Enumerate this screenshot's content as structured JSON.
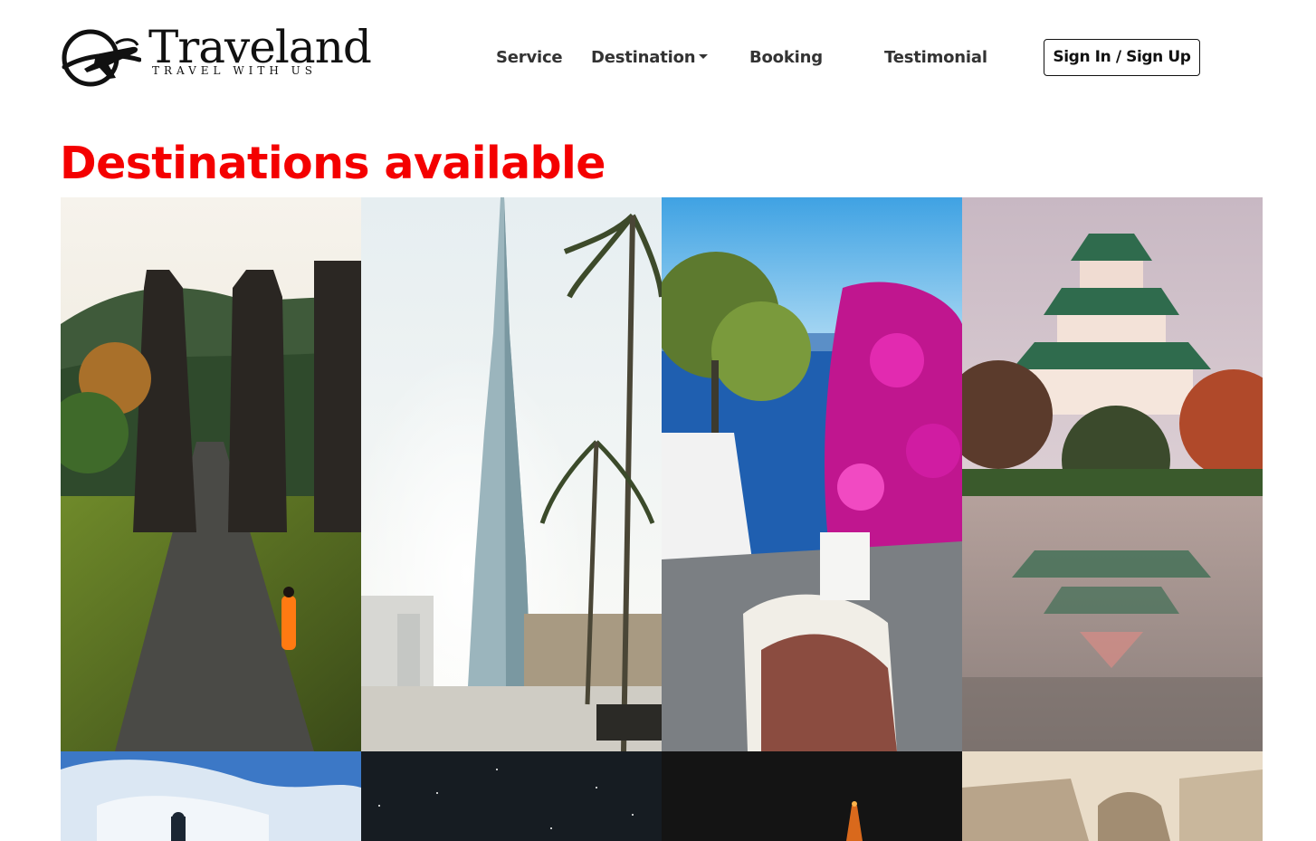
{
  "brand": {
    "name": "Traveland",
    "tagline": "TRAVEL WITH US",
    "logo_icon": "airplane-globe-icon"
  },
  "nav": {
    "items": [
      {
        "label": "Service"
      },
      {
        "label": "Destination",
        "has_dropdown": true
      },
      {
        "label": "Booking"
      },
      {
        "label": "Testimonial"
      }
    ],
    "signin_label": "Sign In / Sign Up"
  },
  "section": {
    "title": "Destinations available",
    "title_color": "#f40000"
  },
  "gallery": {
    "tiles": [
      {
        "scene": "temple-gate-path-photo"
      },
      {
        "scene": "skyscraper-palms-photo"
      },
      {
        "scene": "seaside-bougainvillea-photo"
      },
      {
        "scene": "castle-reflection-photo"
      },
      {
        "scene": "blue-sky-tower-photo"
      },
      {
        "scene": "starry-night-photo"
      },
      {
        "scene": "night-tower-photo"
      },
      {
        "scene": "baroque-statue-photo"
      }
    ]
  }
}
